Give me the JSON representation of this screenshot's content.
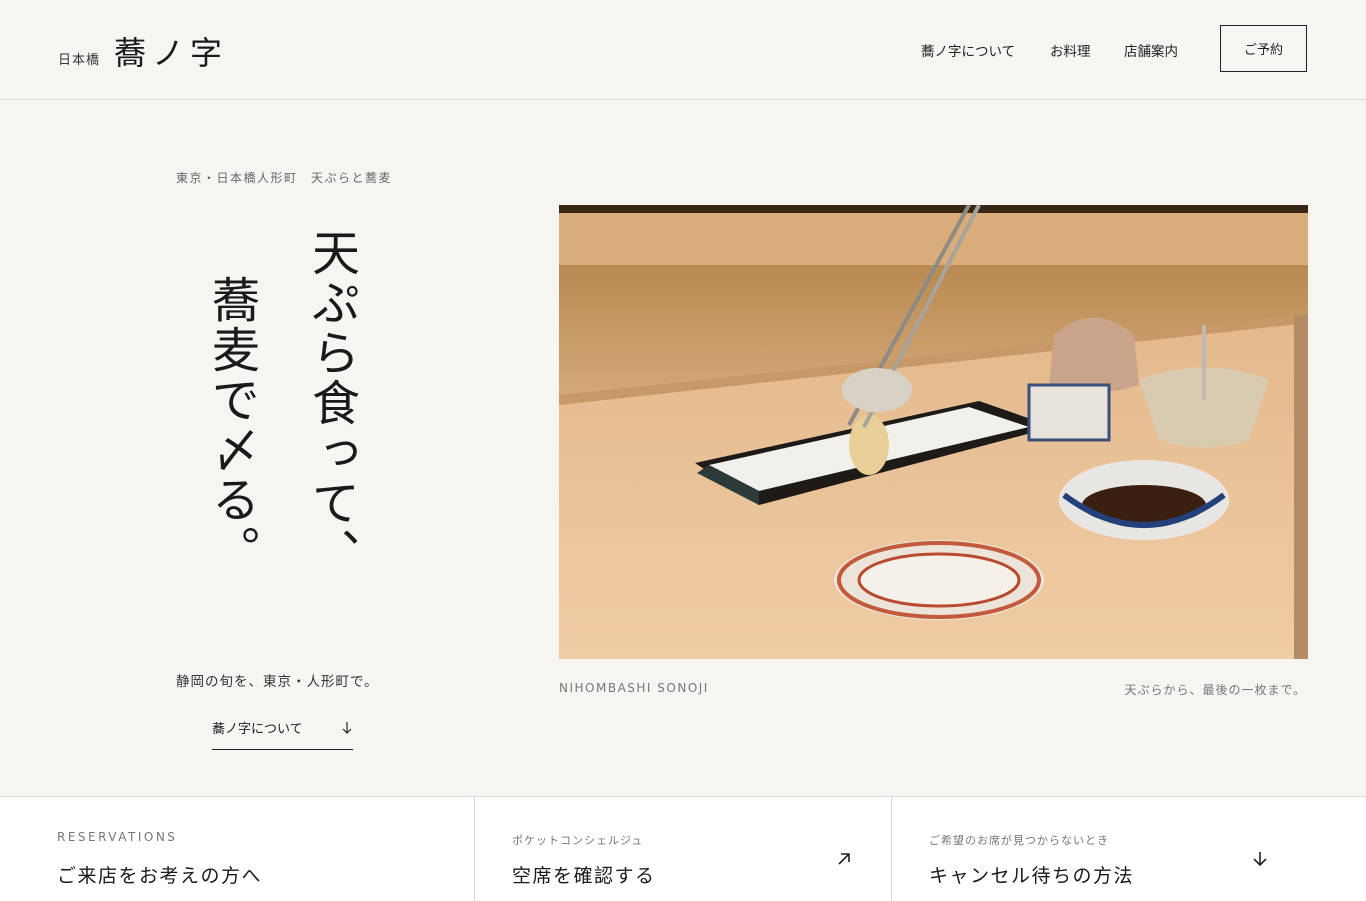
{
  "header": {
    "logo_sub": "日本橋",
    "logo_main": "蕎ノ字",
    "nav": [
      "蕎ノ字について",
      "お料理",
      "店舗案内"
    ],
    "reserve_label": "ご予約"
  },
  "hero": {
    "tagline": "東京・日本橋人形町　天ぷらと蕎麦",
    "headline_col1": "天ぷら食って、",
    "headline_col2": "蕎麦で〆る。",
    "sub_copy": "静岡の旬を、東京・人形町で。",
    "about_link": "蕎ノ字について",
    "caption_left": "NIHOMBASHI SONOJI",
    "caption_right": "天ぷらから、最後の一枚まで。"
  },
  "bottom": {
    "reservations_label": "RESERVATIONS",
    "reservations_title": "ご来店をお考えの方へ",
    "pocket_label": "ポケットコンシェルジュ",
    "pocket_title": "空席を確認する",
    "cancel_label": "ご希望のお席が見つからないとき",
    "cancel_title": "キャンセル待ちの方法"
  },
  "icons": {
    "about_link": "arrow-down-icon",
    "pocket": "arrow-up-right-icon",
    "cancel": "arrow-down-icon"
  },
  "colors": {
    "background": "#f6f5f1",
    "text": "#1f1f1f",
    "muted": "#777777",
    "border": "#dcdad4"
  }
}
